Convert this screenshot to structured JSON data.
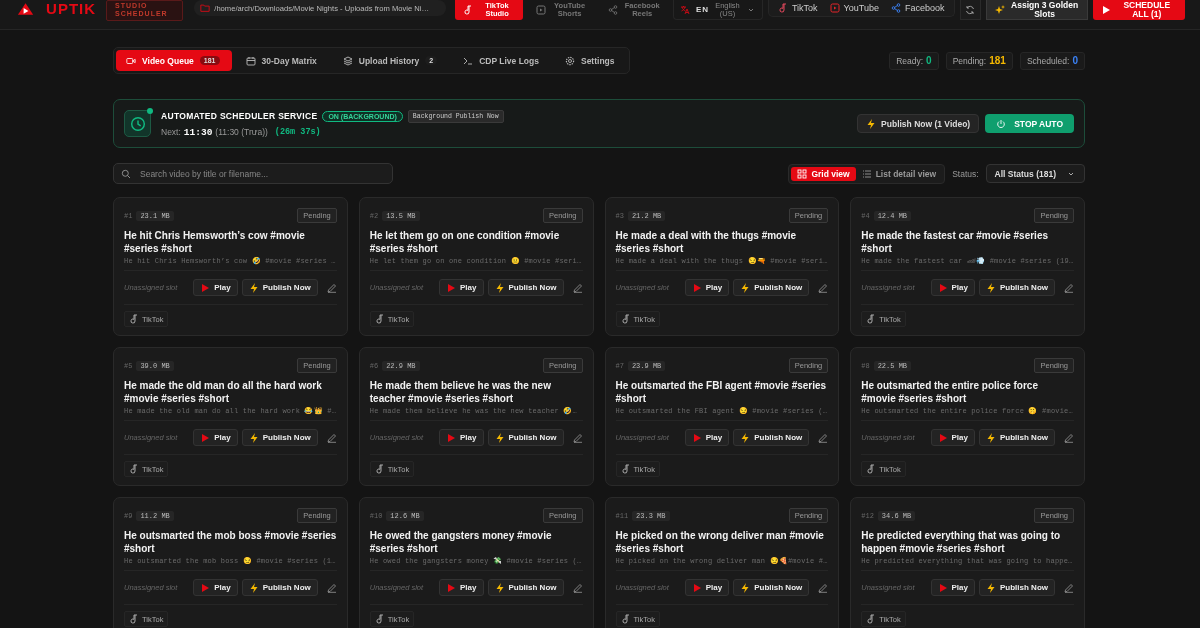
{
  "header": {
    "brand": "UPTIK",
    "brand_badge": "STUDIO SCHEDULER",
    "path": "/home/arch/Downloads/Movie Nights - Uploads from Movie Ni…",
    "platform_tabs": [
      {
        "label": "TikTok Studio",
        "kind": "tiktok",
        "selected": true
      },
      {
        "label": "YouTube Shorts",
        "kind": "youtube",
        "selected": false
      },
      {
        "label": "Facebook Reels",
        "kind": "facebook",
        "selected": false
      }
    ],
    "language": {
      "code": "EN",
      "name": "English (US)"
    },
    "platforms": [
      {
        "label": "TikTok",
        "kind": "tiktok"
      },
      {
        "label": "YouTube",
        "kind": "youtube"
      },
      {
        "label": "Facebook",
        "kind": "facebook"
      }
    ],
    "assign_button": "Assign 3 Golden Slots",
    "schedule_button": "SCHEDULE ALL (1)"
  },
  "nav_tabs": [
    {
      "label": "Video Queue",
      "kind": "video",
      "count": "181",
      "selected": true
    },
    {
      "label": "30-Day Matrix",
      "kind": "calendar",
      "selected": false
    },
    {
      "label": "Upload History",
      "kind": "layers",
      "count": "2",
      "selected": false
    },
    {
      "label": "CDP Live Logs",
      "kind": "terminal",
      "selected": false
    },
    {
      "label": "Settings",
      "kind": "gear",
      "selected": false
    }
  ],
  "stats": [
    {
      "label": "Ready:",
      "value": "0",
      "color": "#10b981"
    },
    {
      "label": "Pending:",
      "value": "181",
      "color": "#f5b800"
    },
    {
      "label": "Scheduled:",
      "value": "0",
      "color": "#3b82f6"
    }
  ],
  "scheduler": {
    "title": "AUTOMATED SCHEDULER SERVICE",
    "status": "ON (BACKGROUND)",
    "mode_chip": "Background Publish Now",
    "next_label": "Next:",
    "next_time": "11:30",
    "next_detail": "(11:30 (Trưa))",
    "countdown": "(26m 37s)",
    "publish_button": "Publish Now (1 Video)",
    "stop_button": "STOP AUTO"
  },
  "search": {
    "placeholder": "Search video by title or filename..."
  },
  "view_toggle": [
    {
      "label": "Grid view",
      "kind": "grid",
      "selected": true
    },
    {
      "label": "List detail view",
      "kind": "list",
      "selected": false
    }
  ],
  "status_filter": {
    "label": "Status:",
    "value": "All Status (181)"
  },
  "cards": [
    {
      "num": "#1",
      "size": "23.1 MB",
      "status": "Pending",
      "title": "He hit Chris Hemsworth’s cow #movie #series #short",
      "desc": "He hit Chris Hemsworth’s cow 🤣 #movie #series …",
      "slot": "Unassigned slot",
      "play": "Play",
      "publish": "Publish Now",
      "platform": "TikTok"
    },
    {
      "num": "#2",
      "size": "13.5 MB",
      "status": "Pending",
      "title": "He let them go on one condition #movie #series #short",
      "desc": "He let them go on one condition 😐 #movie #seri…",
      "slot": "Unassigned slot",
      "play": "Play",
      "publish": "Publish Now",
      "platform": "TikTok"
    },
    {
      "num": "#3",
      "size": "21.2 MB",
      "status": "Pending",
      "title": "He made a deal with the thugs #movie #series #short",
      "desc": "He made a deal with the thugs 😏🔫 #movie #seri…",
      "slot": "Unassigned slot",
      "play": "Play",
      "publish": "Publish Now",
      "platform": "TikTok"
    },
    {
      "num": "#4",
      "size": "12.4 MB",
      "status": "Pending",
      "title": "He made the fastest car #movie #series #short",
      "desc": "He made the fastest car 🏎💨 #movie #series (19…",
      "slot": "Unassigned slot",
      "play": "Play",
      "publish": "Publish Now",
      "platform": "TikTok"
    },
    {
      "num": "#5",
      "size": "39.0 MB",
      "status": "Pending",
      "title": "He made the old man do all the hard work #movie #series #short",
      "desc": "He made the old man do all the hard work 😂👑 #…",
      "slot": "Unassigned slot",
      "play": "Play",
      "publish": "Publish Now",
      "platform": "TikTok"
    },
    {
      "num": "#6",
      "size": "22.9 MB",
      "status": "Pending",
      "title": "He made them believe he was the new teacher #movie #series #short",
      "desc": "He made them believe he was the new teacher 🤣…",
      "slot": "Unassigned slot",
      "play": "Play",
      "publish": "Publish Now",
      "platform": "TikTok"
    },
    {
      "num": "#7",
      "size": "23.9 MB",
      "status": "Pending",
      "title": "He outsmarted the FBI agent #movie #series #short",
      "desc": "He outsmarted the FBI agent 😏 #movie #series (…",
      "slot": "Unassigned slot",
      "play": "Play",
      "publish": "Publish Now",
      "platform": "TikTok"
    },
    {
      "num": "#8",
      "size": "22.5 MB",
      "status": "Pending",
      "title": "He outsmarted the entire police force #movie #series #short",
      "desc": "He outsmarted the entire police force 🤫 #movie…",
      "slot": "Unassigned slot",
      "play": "Play",
      "publish": "Publish Now",
      "platform": "TikTok"
    },
    {
      "num": "#9",
      "size": "11.2 MB",
      "status": "Pending",
      "title": "He outsmarted the mob boss #movie #series #short",
      "desc": "He outsmarted the mob boss 😏 #movie #series (1…",
      "slot": "Unassigned slot",
      "play": "Play",
      "publish": "Publish Now",
      "platform": "TikTok"
    },
    {
      "num": "#10",
      "size": "12.6 MB",
      "status": "Pending",
      "title": "He owed the gangsters money #movie #series #short",
      "desc": "He owed the gangsters money 💸 #movie #series (…",
      "slot": "Unassigned slot",
      "play": "Play",
      "publish": "Publish Now",
      "platform": "TikTok"
    },
    {
      "num": "#11",
      "size": "23.3 MB",
      "status": "Pending",
      "title": "He picked on the wrong deliver man #movie #series #short",
      "desc": "He picked on the wrong deliver man 😏🍕#movie #…",
      "slot": "Unassigned slot",
      "play": "Play",
      "publish": "Publish Now",
      "platform": "TikTok"
    },
    {
      "num": "#12",
      "size": "34.6 MB",
      "status": "Pending",
      "title": "He predicted everything that was going to happen #movie #series #short",
      "desc": "He predicted everything that was going to happe…",
      "slot": "Unassigned slot",
      "play": "Play",
      "publish": "Publish Now",
      "platform": "TikTok"
    }
  ]
}
